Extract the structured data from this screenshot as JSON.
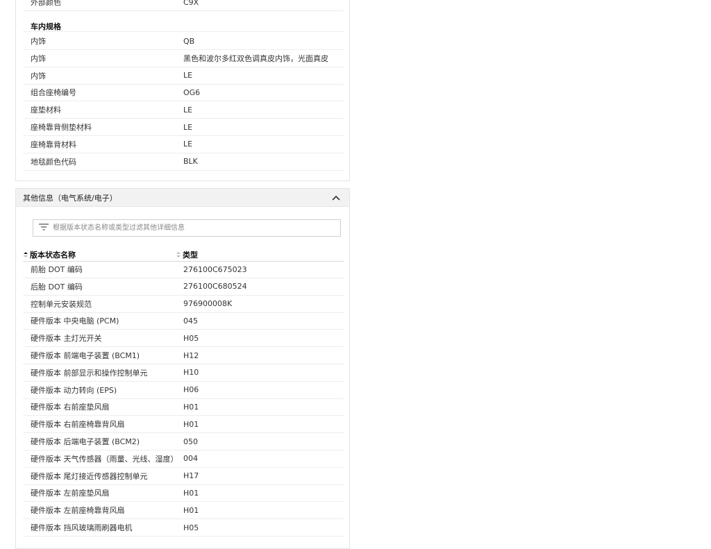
{
  "vehicle_specs": {
    "exterior_row": {
      "label": "外部颜色",
      "value": "C9X"
    },
    "interior_section_title": "车内规格",
    "interior_rows": [
      {
        "label": "内饰",
        "value": "QB"
      },
      {
        "label": "内饰",
        "value": "黑色和波尔多红双色调真皮内饰，光面真皮"
      },
      {
        "label": "内饰",
        "value": "LE"
      },
      {
        "label": "组合座椅编号",
        "value": "OG6"
      },
      {
        "label": "座垫材料",
        "value": "LE"
      },
      {
        "label": "座椅靠背侧垫材料",
        "value": "LE"
      },
      {
        "label": "座椅靠背材料",
        "value": "LE"
      },
      {
        "label": "地毯颜色代码",
        "value": "BLK"
      }
    ]
  },
  "other_info": {
    "title": "其他信息（电气系统/电子）",
    "filter_placeholder": "根据版本状态名称或类型过滤其他详细信息",
    "columns": {
      "name": "版本状态名称",
      "type": "类型"
    },
    "rows": [
      {
        "name": "前胎 DOT 编码",
        "type": "276100C675023"
      },
      {
        "name": "后胎 DOT 编码",
        "type": "276100C680524"
      },
      {
        "name": "控制单元安装规范",
        "type": "976900008K"
      },
      {
        "name": "硬件版本 中央电脑 (PCM)",
        "type": "045"
      },
      {
        "name": "硬件版本 主灯光开关",
        "type": "H05"
      },
      {
        "name": "硬件版本 前端电子装置 (BCM1)",
        "type": "H12"
      },
      {
        "name": "硬件版本 前部显示和操作控制单元",
        "type": "H10"
      },
      {
        "name": "硬件版本 动力转向 (EPS)",
        "type": "H06"
      },
      {
        "name": "硬件版本 右前座垫风扇",
        "type": "H01"
      },
      {
        "name": "硬件版本 右前座椅靠背风扇",
        "type": "H01"
      },
      {
        "name": "硬件版本 后端电子装置 (BCM2)",
        "type": "050"
      },
      {
        "name": "硬件版本 天气传感器（雨量、光线、湿度）",
        "type": "004"
      },
      {
        "name": "硬件版本 尾灯接近传感器控制单元",
        "type": "H17"
      },
      {
        "name": "硬件版本 左前座垫风扇",
        "type": "H01"
      },
      {
        "name": "硬件版本 左前座椅靠背风扇",
        "type": "H01"
      },
      {
        "name": "硬件版本 挡风玻璃雨刷器电机",
        "type": "H05"
      }
    ]
  },
  "icons": {
    "collapse": "chevron-up-icon",
    "filter": "filter-icon",
    "sort": "sort-icon"
  }
}
